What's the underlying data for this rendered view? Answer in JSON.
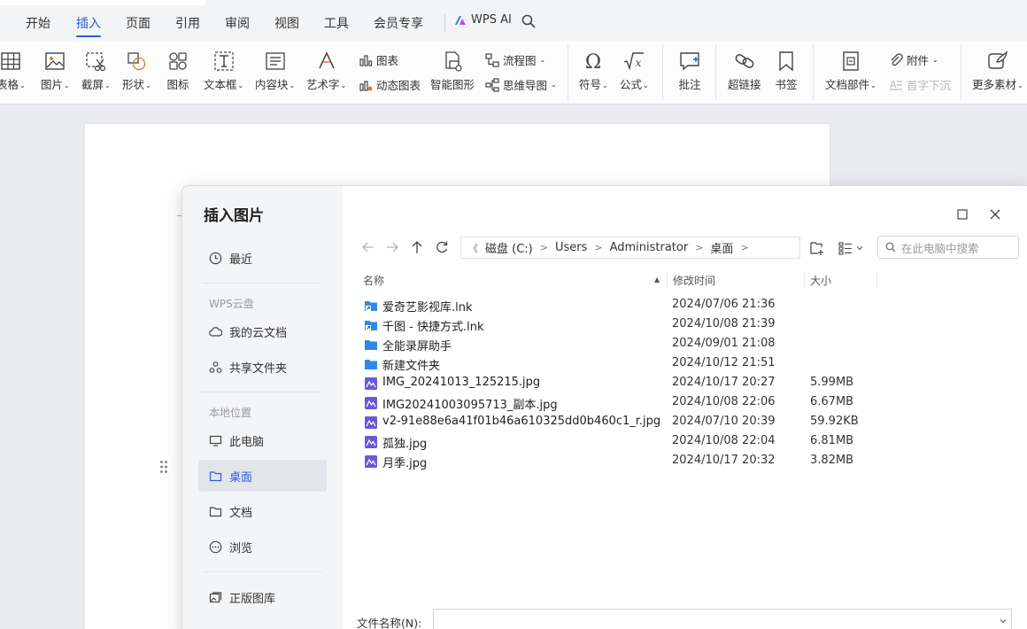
{
  "tabs": [
    {
      "label": "开始",
      "active": false
    },
    {
      "label": "插入",
      "active": true
    },
    {
      "label": "页面",
      "active": false
    },
    {
      "label": "引用",
      "active": false
    },
    {
      "label": "审阅",
      "active": false
    },
    {
      "label": "视图",
      "active": false
    },
    {
      "label": "工具",
      "active": false
    },
    {
      "label": "会员专享",
      "active": false
    }
  ],
  "wps_ai_label": "WPS AI",
  "ribbon": {
    "table": "表格",
    "picture": "图片",
    "screenshot": "截屏",
    "shape": "形状",
    "icon": "图标",
    "textbox": "文本框",
    "content_block": "内容块",
    "wordart": "艺术字",
    "chart": "图表",
    "dynamic_chart": "动态图表",
    "smart_shape": "智能图形",
    "flowchart": "流程图",
    "mindmap": "思维导图",
    "symbol": "符号",
    "formula": "公式",
    "comment": "批注",
    "hyperlink": "超链接",
    "bookmark": "书签",
    "doc_parts": "文档部件",
    "attachment": "附件",
    "dropcap": "首字下沉",
    "more_materials": "更多素材"
  },
  "dialog": {
    "title": "插入图片",
    "nav": {
      "recent": "最近",
      "cloud_group": "WPS云盘",
      "my_cloud_docs": "我的云文档",
      "shared_folders": "共享文件夹",
      "local_group": "本地位置",
      "this_pc": "此电脑",
      "desktop": "桌面",
      "documents": "文档",
      "browse": "浏览",
      "stock_library": "正版图库"
    },
    "breadcrumb": [
      "磁盘 (C:)",
      "Users",
      "Administrator",
      "桌面"
    ],
    "search_placeholder": "在此电脑中搜索",
    "columns": {
      "name": "名称",
      "modified": "修改时间",
      "size": "大小"
    },
    "files": [
      {
        "name": "爱奇艺影视库.lnk",
        "date": "2024/07/06 21:36",
        "size": "",
        "type": "shortcut"
      },
      {
        "name": "千图 - 快捷方式.lnk",
        "date": "2024/10/08 21:39",
        "size": "",
        "type": "shortcut"
      },
      {
        "name": "全能录屏助手",
        "date": "2024/09/01 21:08",
        "size": "",
        "type": "folder"
      },
      {
        "name": "新建文件夹",
        "date": "2024/10/12 21:51",
        "size": "",
        "type": "folder"
      },
      {
        "name": "IMG_20241013_125215.jpg",
        "date": "2024/10/17 20:27",
        "size": "5.99MB",
        "type": "image"
      },
      {
        "name": "IMG20241003095713_副本.jpg",
        "date": "2024/10/08 22:06",
        "size": "6.67MB",
        "type": "image"
      },
      {
        "name": "v2-91e88e6a41f01b46a610325dd0b460c1_r.jpg",
        "date": "2024/07/10 20:39",
        "size": "59.92KB",
        "type": "image"
      },
      {
        "name": "孤独.jpg",
        "date": "2024/10/08 22:04",
        "size": "6.81MB",
        "type": "image"
      },
      {
        "name": "月季.jpg",
        "date": "2024/10/17 20:32",
        "size": "3.82MB",
        "type": "image"
      }
    ],
    "filename_label": "文件名称(N):",
    "filename_value": ""
  },
  "colors": {
    "accent": "#2c5fd4",
    "folder": "#2e8ae6",
    "image_icon": "#6a5ad8"
  }
}
